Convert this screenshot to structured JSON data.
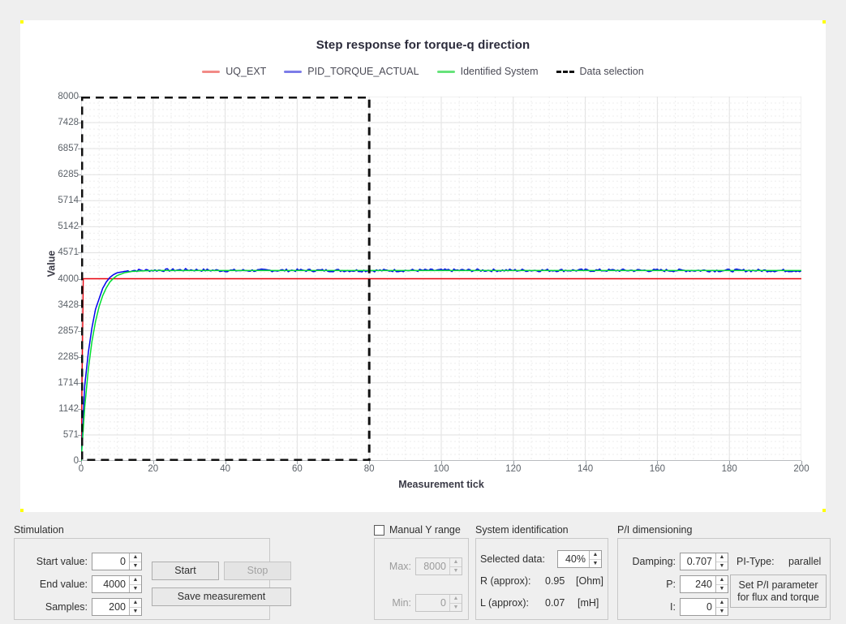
{
  "chart_data": {
    "type": "line",
    "title": "Step response for torque-q direction",
    "xlabel": "Measurement tick",
    "ylabel": "Value",
    "xlim": [
      0,
      200
    ],
    "ylim": [
      0,
      8000
    ],
    "grid": true,
    "legend_position": "top-center",
    "xticks": [
      "0",
      "20",
      "40",
      "60",
      "80",
      "100",
      "120",
      "140",
      "160",
      "180",
      "200"
    ],
    "xtick_values": [
      0,
      20,
      40,
      60,
      80,
      100,
      120,
      140,
      160,
      180,
      200
    ],
    "yticks": [
      "0",
      "571",
      "1142",
      "1714",
      "2285",
      "2857",
      "3428",
      "4000",
      "4571",
      "5142",
      "5714",
      "6285",
      "6857",
      "7428",
      "8000"
    ],
    "ytick_values": [
      0,
      571,
      1142,
      1714,
      2285,
      2857,
      3428,
      4000,
      4571,
      5142,
      5714,
      6285,
      6857,
      7428,
      8000
    ],
    "series": [
      {
        "name": "UQ_EXT",
        "color": "#e8000b",
        "legend_color": "#f28a86",
        "style": "solid",
        "description": "constant step command at 4000",
        "x": [
          0,
          1,
          200
        ],
        "values": [
          0,
          4000,
          4000
        ]
      },
      {
        "name": "PID_TORQUE_ACTUAL",
        "color": "#0000ee",
        "legend_color": "#7c7ce8",
        "style": "solid",
        "description": "measured torque current, first-order rise to ~4180 with measurement noise",
        "x": [
          0,
          1,
          2,
          3,
          4,
          5,
          6,
          7,
          8,
          9,
          10,
          12,
          14,
          16,
          20,
          30,
          40,
          60,
          80,
          100,
          140,
          200
        ],
        "values": [
          0,
          1650,
          2380,
          2920,
          3330,
          3560,
          3790,
          3930,
          4030,
          4090,
          4130,
          4160,
          4180,
          4185,
          4185,
          4195,
          4180,
          4185,
          4180,
          4185,
          4185,
          4180
        ]
      },
      {
        "name": "Identified System",
        "color": "#00dd30",
        "legend_color": "#66e37a",
        "style": "solid",
        "description": "model fit, first-order rise to ~4180",
        "x": [
          0,
          1,
          2,
          3,
          4,
          5,
          6,
          7,
          8,
          9,
          10,
          12,
          14,
          16,
          20,
          40,
          80,
          120,
          160,
          200
        ],
        "values": [
          0,
          1180,
          2010,
          2620,
          3060,
          3390,
          3630,
          3800,
          3930,
          4010,
          4070,
          4130,
          4160,
          4170,
          4180,
          4180,
          4180,
          4180,
          4180,
          4180
        ]
      }
    ],
    "annotations": [
      {
        "name": "Data selection",
        "type": "dashed-rect",
        "color": "#111111",
        "x_range": [
          0,
          80
        ],
        "y_range": [
          0,
          8000
        ]
      }
    ]
  },
  "chart": {
    "title": "Step response for torque-q direction",
    "xlabel": "Measurement tick",
    "ylabel": "Value",
    "legend": [
      {
        "label": "UQ_EXT",
        "color": "#f28a86",
        "style": "solid"
      },
      {
        "label": "PID_TORQUE_ACTUAL",
        "color": "#7c7ce8",
        "style": "solid"
      },
      {
        "label": "Identified System",
        "color": "#66e37a",
        "style": "solid"
      },
      {
        "label": "Data selection",
        "color": "#111111",
        "style": "dashed"
      }
    ]
  },
  "stimulation": {
    "title": "Stimulation",
    "start_value_label": "Start value:",
    "start_value": "0",
    "end_value_label": "End value:",
    "end_value": "4000",
    "samples_label": "Samples:",
    "samples": "200",
    "start_button": "Start",
    "stop_button": "Stop",
    "save_button": "Save measurement"
  },
  "manual_y_range": {
    "checkbox_label": "Manual Y  range",
    "checked": false,
    "max_label": "Max:",
    "max_value": "8000",
    "min_label": "Min:",
    "min_value": "0"
  },
  "system_identification": {
    "title": "System identification",
    "selected_data_label": "Selected data:",
    "selected_data_value": "40%",
    "r_label": "R (approx):",
    "r_value": "0.95",
    "r_unit": "[Ohm]",
    "l_label": "L (approx):",
    "l_value": "0.07",
    "l_unit": "[mH]"
  },
  "pi_dimensioning": {
    "title": "P/I dimensioning",
    "damping_label": "Damping:",
    "damping_value": "0.707",
    "p_label": "P:",
    "p_value": "240",
    "i_label": "I:",
    "i_value": "0",
    "pi_type_label": "PI-Type:",
    "pi_type_value": "parallel",
    "set_button_line1": "Set P/I parameter",
    "set_button_line2": "for flux and torque"
  },
  "icons": {
    "spin_up": "▲",
    "spin_down": "▼"
  }
}
